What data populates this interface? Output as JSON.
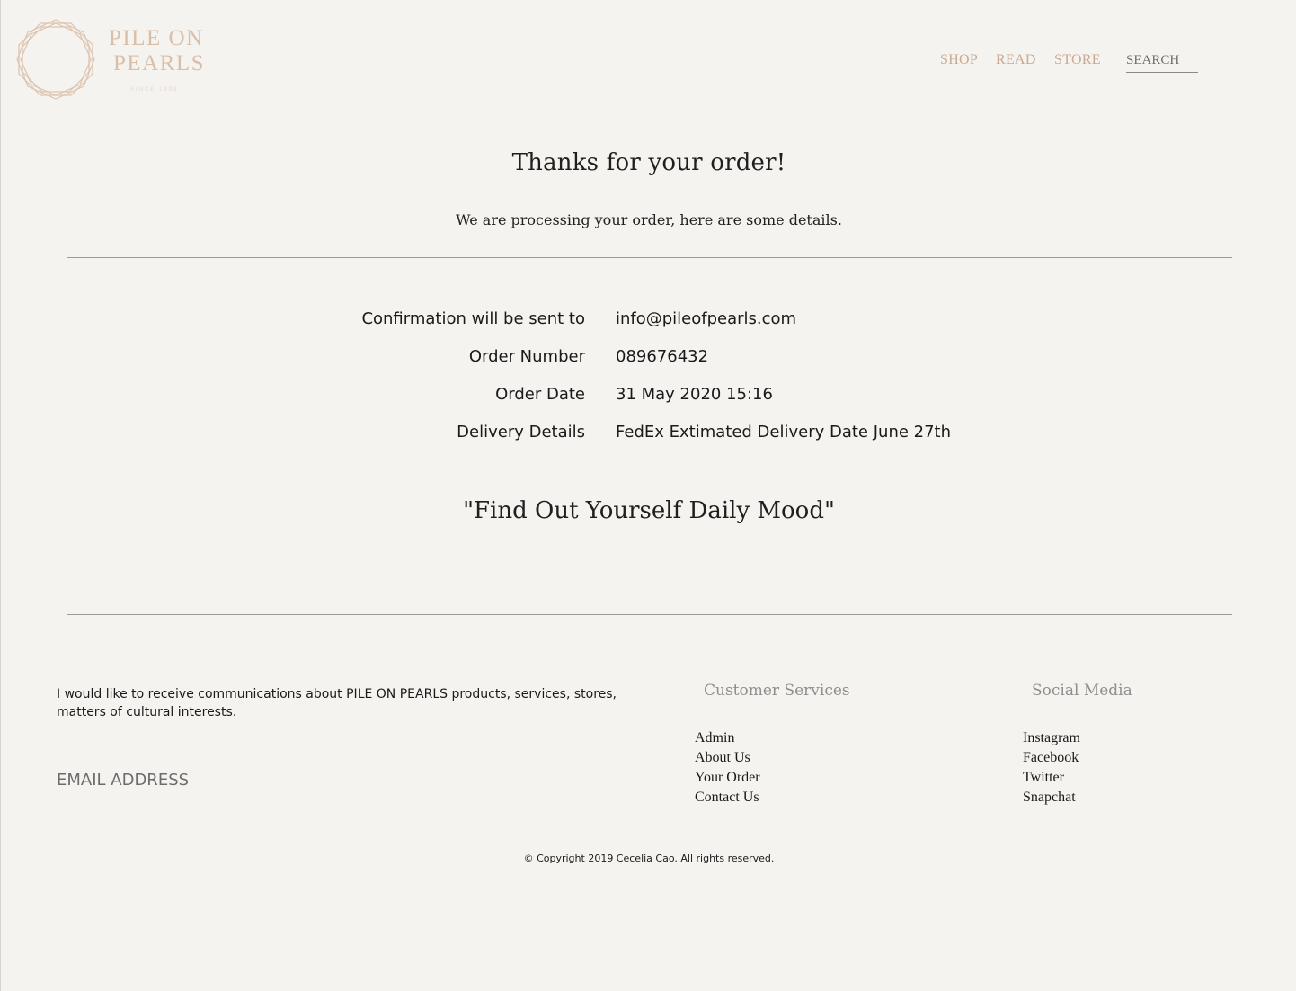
{
  "brand": {
    "name_line_1": "PILE ON",
    "name_line_2": "PEARLS",
    "tagline": "SINCE 1999",
    "logo_icon": "octagon-logo-icon",
    "color": "#d9bfa9"
  },
  "nav": {
    "items": [
      {
        "label": "SHOP"
      },
      {
        "label": "READ"
      },
      {
        "label": "STORE"
      }
    ],
    "color": "#c9a98f"
  },
  "search": {
    "placeholder": "SEARCH",
    "value": ""
  },
  "confirmation": {
    "title": "Thanks for your order!",
    "subtitle": "We are processing your order, here are some details.",
    "details": [
      {
        "label": "Confirmation will be sent to",
        "value": "info@pileofpearls.com"
      },
      {
        "label": "Order Number",
        "value": "089676432"
      },
      {
        "label": "Order Date",
        "value": "31 May 2020 15:16"
      },
      {
        "label": "Delivery Details",
        "value": "FedEx Extimated Delivery Date June 27th"
      }
    ],
    "mood": "\"Find Out Yourself Daily Mood\""
  },
  "footer": {
    "newsletter_text": "I would like to receive communications about PILE ON PEARLS products, services, stores, matters of cultural interests.",
    "email": {
      "placeholder": "EMAIL ADDRESS",
      "value": ""
    },
    "customer_services": {
      "heading": "Customer Services",
      "links": [
        "Admin",
        "About Us",
        "Your Order",
        "Contact Us"
      ]
    },
    "social_media": {
      "heading": "Social Media",
      "links": [
        "Instagram",
        "Facebook",
        "Twitter",
        "Snapchat"
      ]
    },
    "copyright": "© Copyright 2019 Cecelia Cao. All rights reserved."
  },
  "colors": {
    "background": "#f5f3ef",
    "rule": "#9a9a9a",
    "heading_muted": "#8e8e8e"
  }
}
